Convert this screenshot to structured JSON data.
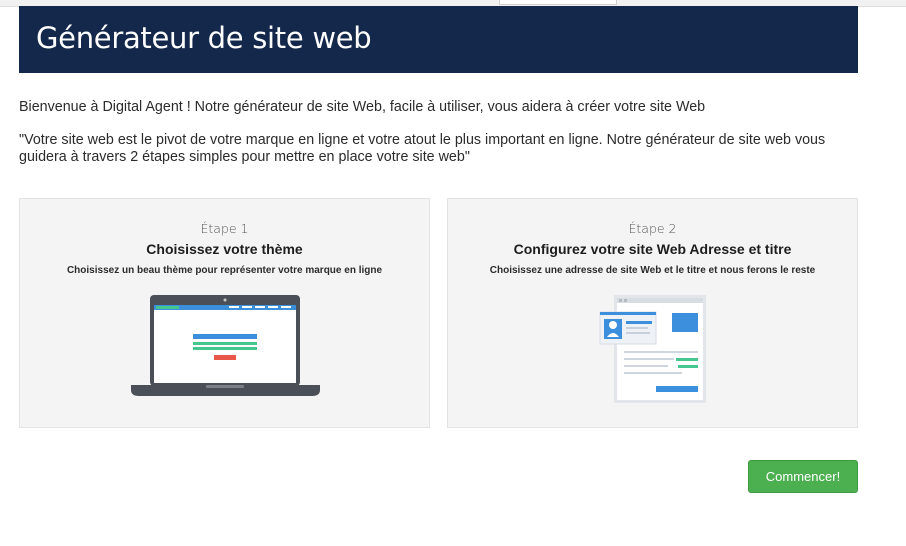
{
  "header": {
    "title": "Générateur de site web"
  },
  "intro": "Bienvenue à Digital Agent ! Notre générateur de site Web, facile à utiliser, vous aidera à créer votre site Web",
  "quote": "\"Votre site web est le pivot de votre marque en ligne et votre atout le plus important en ligne. Notre générateur de site web vous guidera à travers 2 étapes simples pour mettre en place votre site web\"",
  "steps": [
    {
      "step": "Étape 1",
      "title": "Choisissez votre thème",
      "description": "Choisissez un beau thème pour représenter votre marque en ligne",
      "icon": "laptop-theme-icon"
    },
    {
      "step": "Étape 2",
      "title": "Configurez votre site Web Adresse et titre",
      "description": "Choisissez une adresse de site Web et le titre et nous ferons le reste",
      "icon": "website-config-icon"
    }
  ],
  "actions": {
    "start_label": "Commencer!"
  },
  "colors": {
    "header_bg": "#13284a",
    "button_bg": "#4caf50",
    "card_bg": "#f4f4f4",
    "accent_blue": "#3b8fdc",
    "accent_green": "#46c68f",
    "accent_red": "#e8574a"
  }
}
